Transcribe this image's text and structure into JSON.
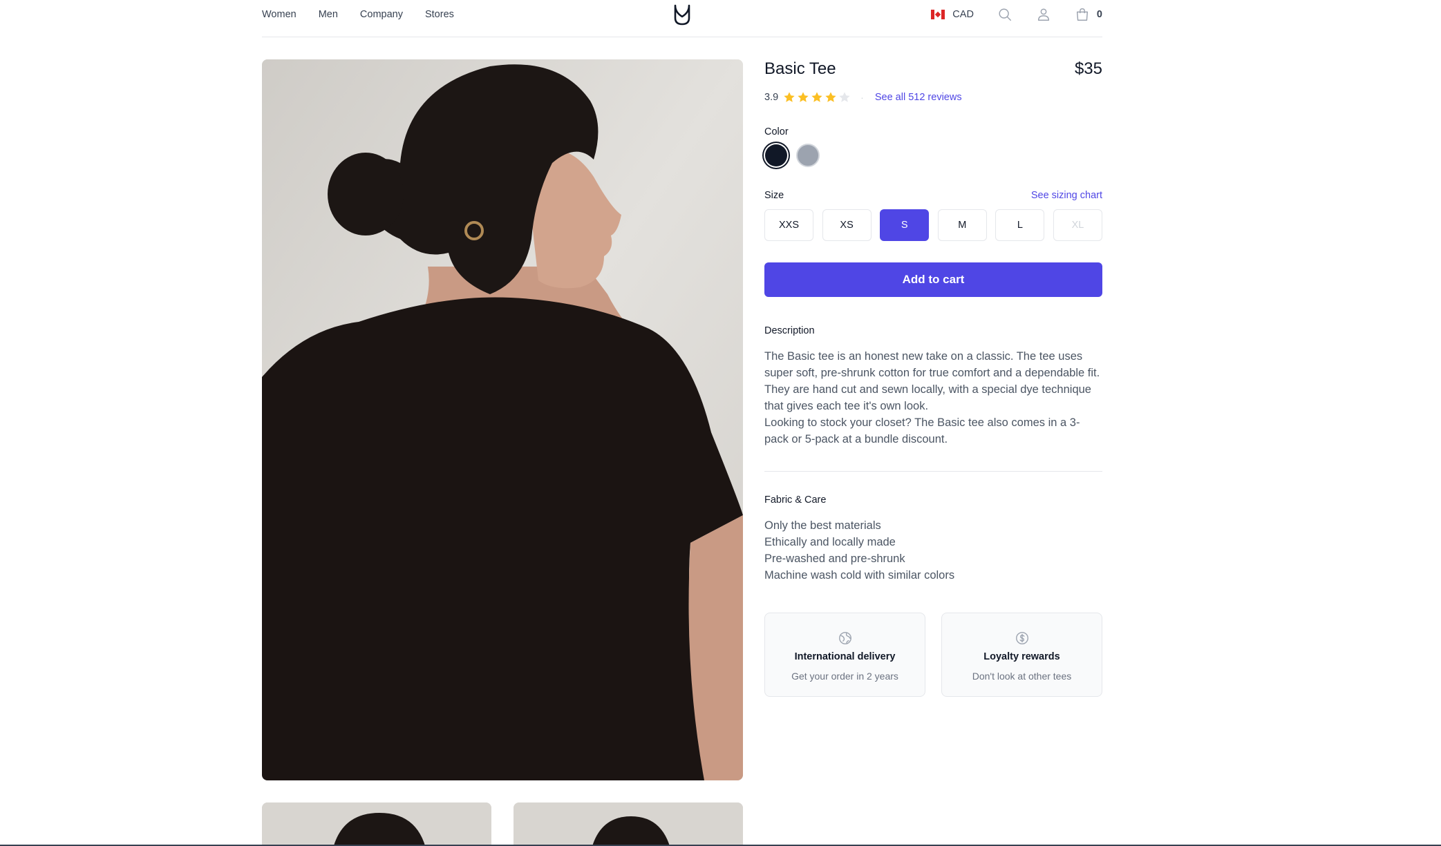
{
  "nav": {
    "items": [
      "Women",
      "Men",
      "Company",
      "Stores"
    ]
  },
  "header": {
    "currency": "CAD",
    "cart_count": "0"
  },
  "product": {
    "title": "Basic Tee",
    "price": "$35",
    "rating": "3.9",
    "rating_value": 3.9,
    "rating_max": 5,
    "reviews_link": "See all 512 reviews",
    "color_label": "Color",
    "colors": [
      {
        "name": "navy",
        "hex": "#111827",
        "selected": true
      },
      {
        "name": "gray",
        "hex": "#9ca3af",
        "selected": false
      }
    ],
    "size_label": "Size",
    "sizing_chart_link": "See sizing chart",
    "sizes": [
      "XXS",
      "XS",
      "S",
      "M",
      "L",
      "XL"
    ],
    "selected_size": "S",
    "unavailable_sizes": [
      "XL"
    ],
    "add_to_cart": "Add to cart",
    "description_label": "Description",
    "description": [
      "The Basic tee is an honest new take on a classic. The tee uses super soft, pre-shrunk cotton for true comfort and a dependable fit. They are hand cut and sewn locally, with a special dye technique that gives each tee it's own look.",
      "Looking to stock your closet? The Basic tee also comes in a 3-pack or 5-pack at a bundle discount."
    ],
    "fabric_label": "Fabric & Care",
    "fabric": [
      "Only the best materials",
      "Ethically and locally made",
      "Pre-washed and pre-shrunk",
      "Machine wash cold with similar colors"
    ]
  },
  "cards": [
    {
      "title": "International delivery",
      "subtitle": "Get your order in 2 years",
      "icon": "globe-icon"
    },
    {
      "title": "Loyalty rewards",
      "subtitle": "Don't look at other tees",
      "icon": "currency-dollar-icon"
    }
  ],
  "colors": {
    "accent": "#4f46e5",
    "text": "#111827",
    "muted": "#4b5563",
    "star": "#fbbf24"
  }
}
